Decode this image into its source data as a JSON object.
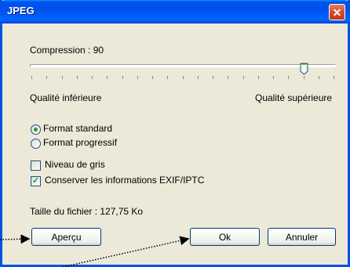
{
  "window": {
    "title": "JPEG",
    "close_glyph": "✕"
  },
  "compression": {
    "label": "Compression : 90",
    "value": 90,
    "min": 0,
    "max": 100,
    "min_label": "Qualité inférieure",
    "max_label": "Qualité supérieure"
  },
  "format": {
    "options": [
      {
        "label": "Format standard",
        "selected": true
      },
      {
        "label": "Format progressif",
        "selected": false
      }
    ]
  },
  "options": {
    "grayscale_label": "Niveau de gris",
    "grayscale_checked": false,
    "exif_label": "Conserver les informations EXIF/IPTC",
    "exif_checked": true
  },
  "file_size": {
    "label": "Taille du fichier : 127,75 Ko"
  },
  "buttons": {
    "preview": "Aperçu",
    "ok": "Ok",
    "cancel": "Annuler"
  },
  "colors": {
    "titlebar": "#0054e3",
    "close": "#d44b2b",
    "face": "#ece9d8",
    "check_green": "#21a121"
  }
}
